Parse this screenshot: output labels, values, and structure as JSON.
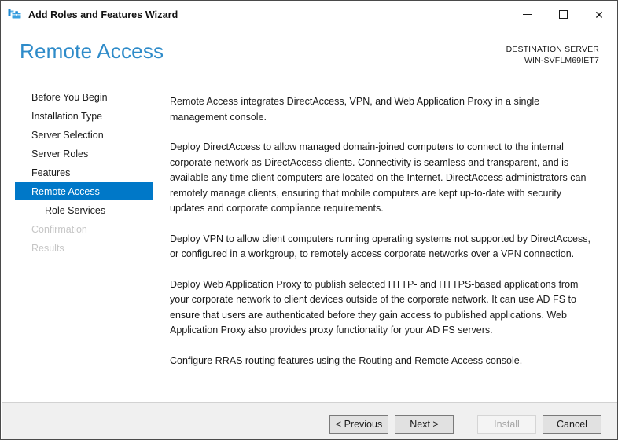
{
  "window": {
    "title": "Add Roles and Features Wizard",
    "icon": "server-manager-icon"
  },
  "caption_buttons": {
    "minimize": "—",
    "maximize": "□",
    "close": "✕"
  },
  "header": {
    "page_title": "Remote Access",
    "destination_label": "DESTINATION SERVER",
    "destination_server": "WIN-SVFLM69IET7"
  },
  "sidebar": {
    "items": [
      {
        "label": "Before You Begin",
        "state": "normal",
        "indent": false
      },
      {
        "label": "Installation Type",
        "state": "normal",
        "indent": false
      },
      {
        "label": "Server Selection",
        "state": "normal",
        "indent": false
      },
      {
        "label": "Server Roles",
        "state": "normal",
        "indent": false
      },
      {
        "label": "Features",
        "state": "normal",
        "indent": false
      },
      {
        "label": "Remote Access",
        "state": "selected",
        "indent": false
      },
      {
        "label": "Role Services",
        "state": "normal",
        "indent": true
      },
      {
        "label": "Confirmation",
        "state": "disabled",
        "indent": false
      },
      {
        "label": "Results",
        "state": "disabled",
        "indent": false
      }
    ]
  },
  "content": {
    "paragraphs": [
      "Remote Access integrates DirectAccess, VPN, and Web Application Proxy in a single management console.",
      "Deploy DirectAccess to allow managed domain-joined computers to connect to the internal corporate network as DirectAccess clients. Connectivity is seamless and transparent, and is available any time client computers are located on the Internet. DirectAccess administrators can remotely manage clients, ensuring that mobile computers are kept up-to-date with security updates and corporate compliance requirements.",
      "Deploy VPN to allow client computers running operating systems not supported by DirectAccess, or configured in a workgroup, to remotely access corporate networks over a VPN connection.",
      "Deploy Web Application Proxy to publish selected HTTP- and HTTPS-based applications from your corporate network to client devices outside of the corporate network. It can use AD FS to ensure that users are authenticated before they gain access to published applications. Web Application Proxy also provides proxy functionality for your AD FS servers.",
      "Configure RRAS routing features using the Routing and Remote Access console."
    ]
  },
  "footer": {
    "previous_label": "< Previous",
    "next_label": "Next >",
    "install_label": "Install",
    "install_enabled": false,
    "cancel_label": "Cancel"
  },
  "colors": {
    "accent_blue": "#2e8bc9",
    "selection_blue": "#0078c8",
    "text": "#1a1a1a",
    "disabled_text": "#c6c6c6",
    "footer_bg": "#f0f0f0"
  }
}
